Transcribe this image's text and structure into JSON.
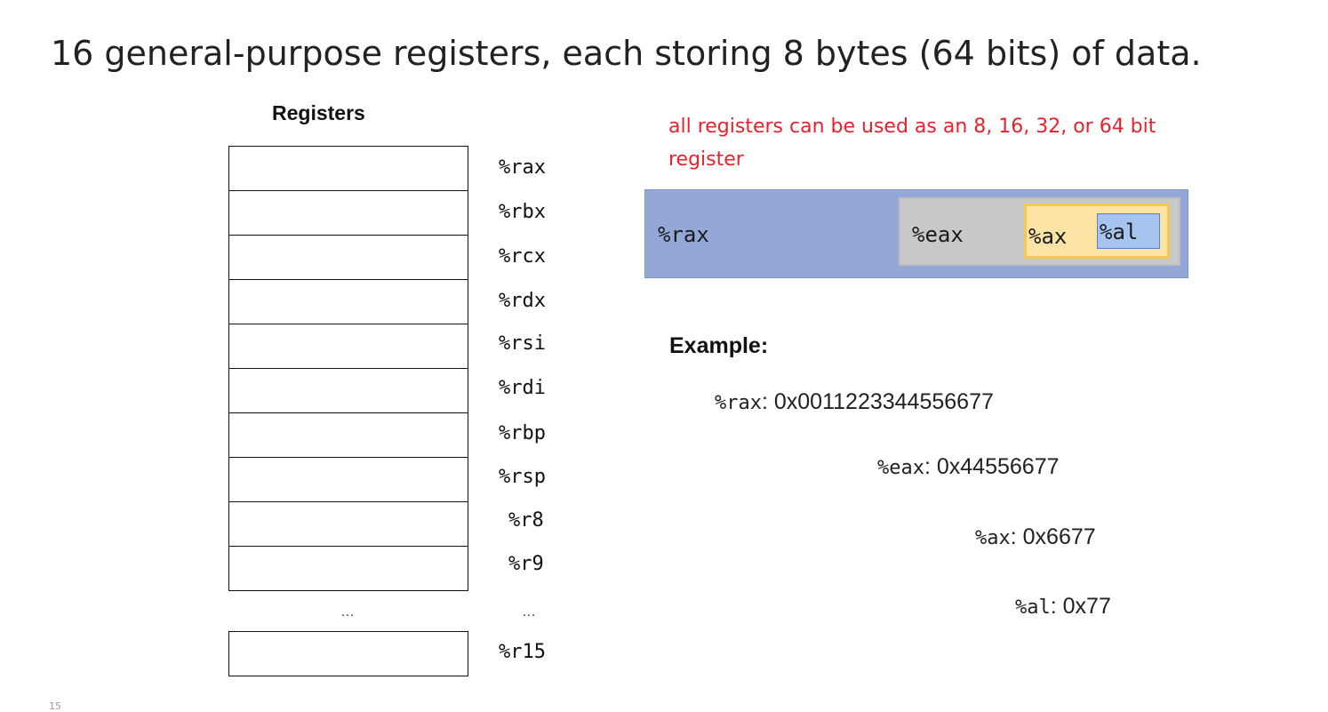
{
  "slide": {
    "title": "16 general-purpose registers, each storing 8 bytes (64 bits) of data.",
    "page_number": "15"
  },
  "registers": {
    "heading": "Registers",
    "names": [
      "%rax",
      "%rbx",
      "%rcx",
      "%rdx",
      "%rsi",
      "%rdi",
      "%rbp",
      "%rsp",
      "%r8",
      "%r9"
    ],
    "ellipsis_left": "…",
    "ellipsis_right": "…",
    "last_name": "%r15"
  },
  "sub_register_diagram": {
    "note": "all registers can be used as an 8, 16, 32, or 64 bit register",
    "rax": "%rax",
    "eax": "%eax",
    "ax": "%ax",
    "al": "%al",
    "colors": {
      "note_text": "#e8222a",
      "rax_fill": "#94a8d8",
      "eax_fill": "#c8c8c8",
      "ax_fill": "#fbe3a6",
      "al_fill": "#a6c4ee"
    }
  },
  "example": {
    "heading": "Example:",
    "lines": [
      {
        "reg": "%rax",
        "value": ": 0x0011223344556677"
      },
      {
        "reg": "%eax",
        "value": ": 0x44556677"
      },
      {
        "reg": "%ax",
        "value": ": 0x6677"
      },
      {
        "reg": "%al",
        "value": ": 0x77"
      }
    ]
  }
}
